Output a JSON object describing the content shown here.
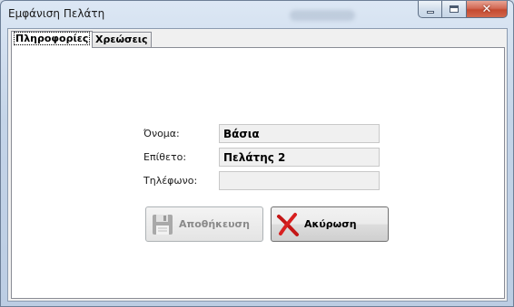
{
  "window": {
    "title": "Εμφάνιση Πελάτη",
    "controls": {
      "minimize_icon": "minimize-icon",
      "maximize_icon": "maximize-icon",
      "close_icon": "close-icon"
    }
  },
  "tabs": [
    {
      "label": "Πληροφορίες",
      "active": true
    },
    {
      "label": "Χρεώσεις",
      "active": false
    }
  ],
  "form": {
    "name_label": "Όνομα:",
    "name_value": "Βάσια",
    "surname_label": "Επίθετο:",
    "surname_value": "Πελάτης 2",
    "phone_label": "Τηλέφωνο:",
    "phone_value": ""
  },
  "buttons": {
    "save": {
      "label": "Αποθήκευση",
      "icon": "floppy-disk-icon",
      "enabled": false
    },
    "cancel": {
      "label": "Ακύρωση",
      "icon": "red-x-icon",
      "enabled": true
    }
  },
  "colors": {
    "titlebar": "#c4d4e8",
    "close_button": "#c44a30",
    "cancel_x": "#d41e1e",
    "disabled_text": "#8a8a8a"
  }
}
